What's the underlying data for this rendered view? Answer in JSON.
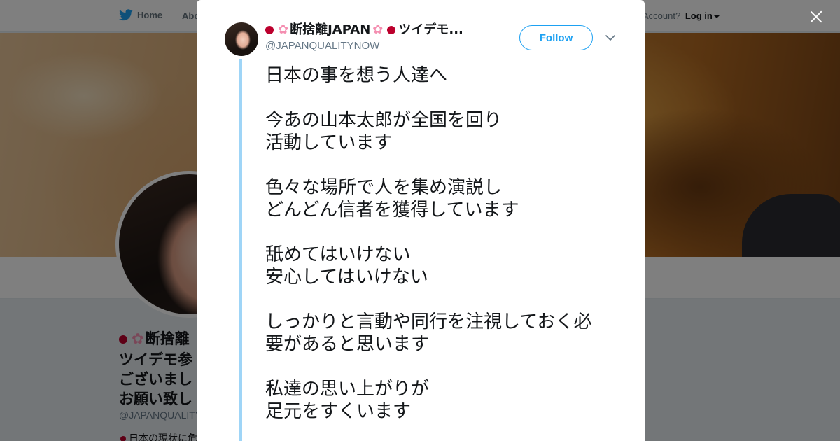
{
  "topbar": {
    "home_label": "Home",
    "about_label": "Abo",
    "account_prompt": "Account?",
    "login_label": "Log in"
  },
  "profile": {
    "name": "断捨離",
    "bio_lines": [
      "ツイデモ参",
      "ございまし",
      "お願い致し"
    ],
    "handle": "@JAPANQUALITY",
    "desc": "日本の現状に危"
  },
  "tweet": {
    "author_name": "断捨離JAPAN",
    "author_name_tail": "ツイデモ...",
    "handle": "@JAPANQUALITYNOW",
    "follow_label": "Follow",
    "paragraphs": [
      "日本の事を想う人達へ",
      "今あの山本太郎が全国を回り\n活動しています",
      "色々な場所で人を集め演説し\nどんどん信者を獲得しています",
      "舐めてはいけない\n安心してはいけない",
      "しっかりと言動や同行を注視しておく必\n要があると思います",
      "私達の思い上がりが\n足元をすくいます"
    ]
  },
  "colors": {
    "twitter_blue": "#1da1f2",
    "thread_line": "#9fd5f7",
    "overlay": "rgba(0,0,0,0.5)",
    "flag_red": "#bc002d",
    "sakura_pink": "#f48fb1"
  },
  "icons": {
    "logo": "twitter-bird-icon",
    "close": "close-icon",
    "caret": "chevron-down-icon",
    "flag": "japan-flag-icon",
    "flower": "cherry-blossom-icon"
  }
}
